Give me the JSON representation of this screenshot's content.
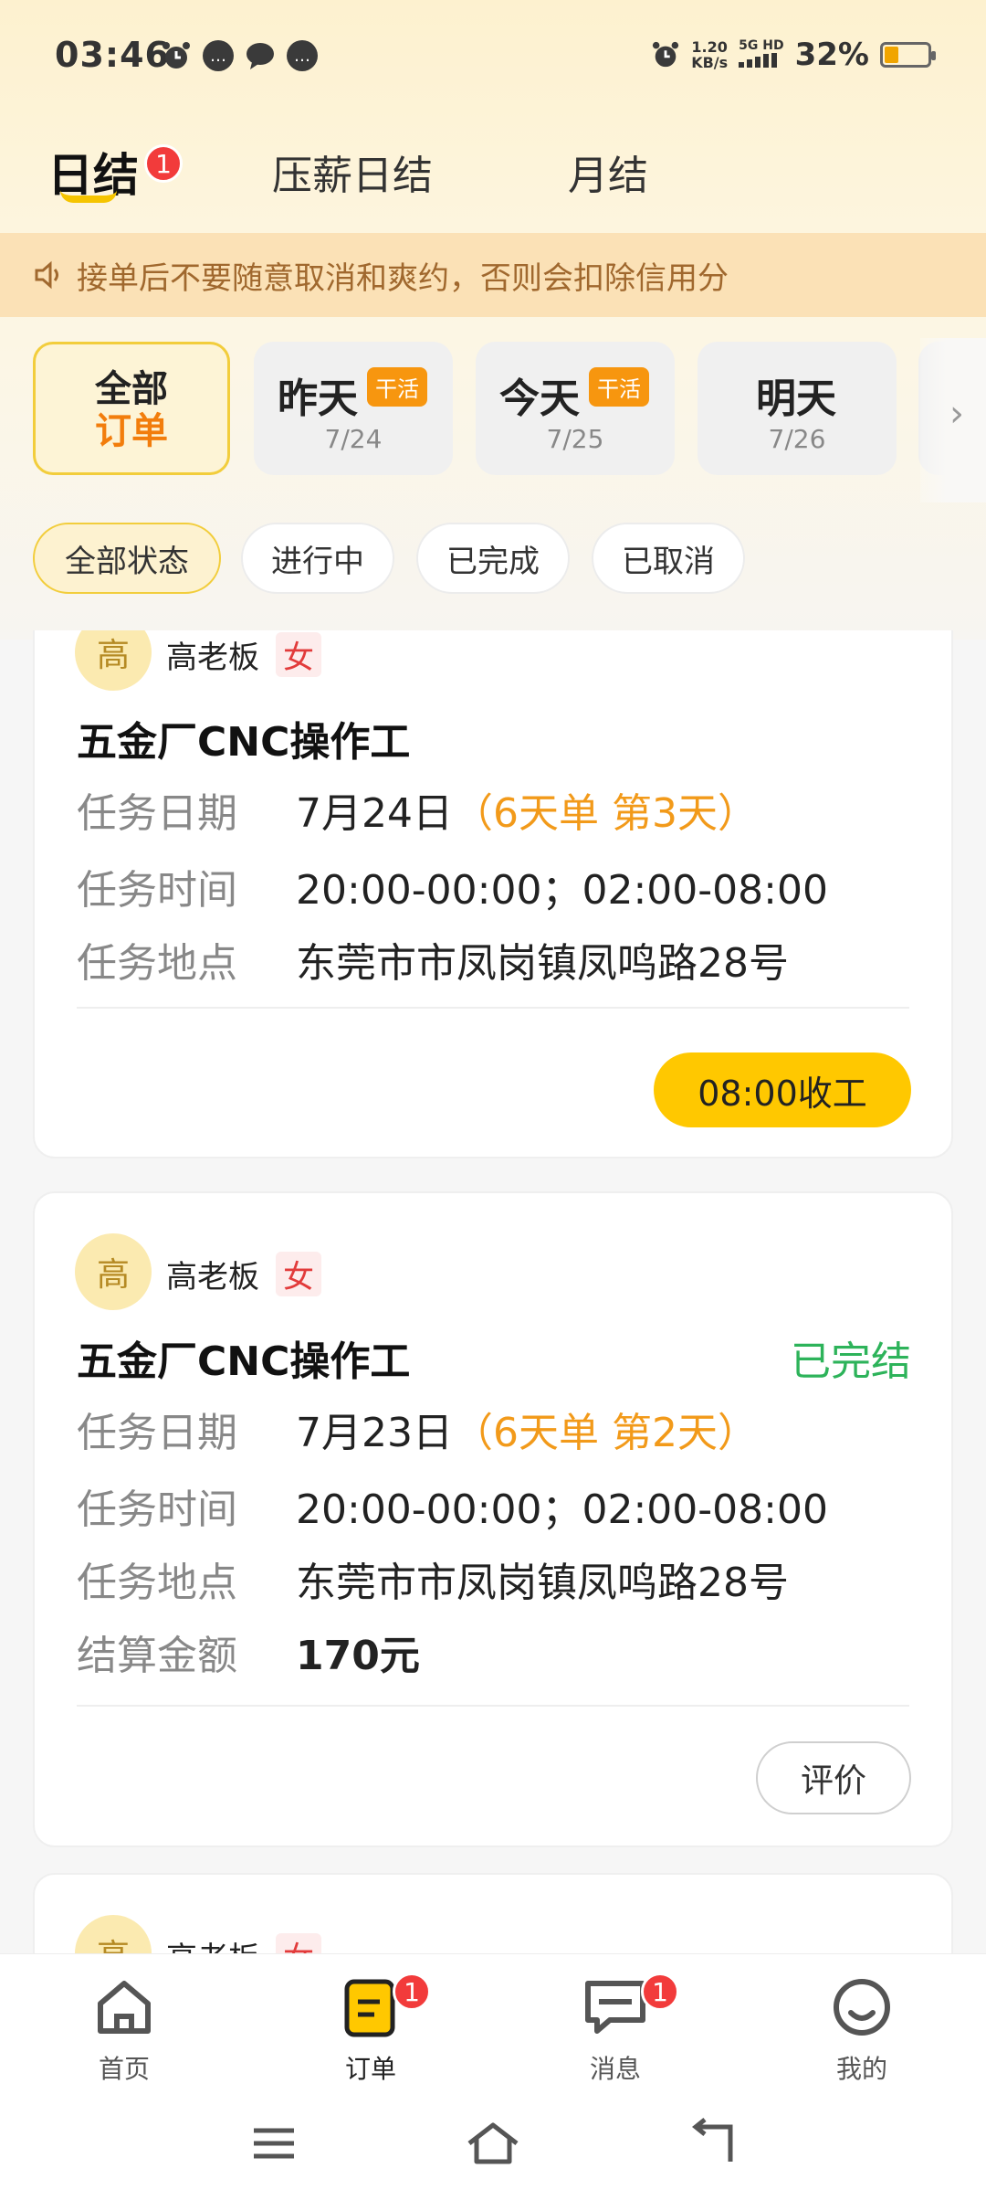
{
  "statusbar": {
    "time": "03:46",
    "speed_value": "1.20",
    "speed_unit": "KB/s",
    "network": "5G HD",
    "battery": "32%",
    "battery_level": 0.32
  },
  "tabs": [
    {
      "label": "日结",
      "badge": "1"
    },
    {
      "label": "压薪日结"
    },
    {
      "label": "月结"
    }
  ],
  "notice": "接单后不要随意取消和爽约，否则会扣除信用分",
  "dates": {
    "all_line1": "全部",
    "all_line2": "订单",
    "items": [
      {
        "label": "昨天",
        "date": "7/24",
        "tag": "干活"
      },
      {
        "label": "今天",
        "date": "7/25",
        "tag": "干活"
      },
      {
        "label": "明天",
        "date": "7/26"
      }
    ]
  },
  "filters": [
    "全部状态",
    "进行中",
    "已完成",
    "已取消"
  ],
  "orders": [
    {
      "avatar": "高",
      "owner": "高老板",
      "gender": "女",
      "job": "五金厂CNC操作工",
      "status": "",
      "date_label": "任务日期",
      "date_value": "7月24日",
      "date_extra": "（6天单 第3天）",
      "time_label": "任务时间",
      "time_value": "20:00-00:00；02:00-08:00",
      "place_label": "任务地点",
      "place_value": "东莞市市凤岗镇凤鸣路28号",
      "button": "08:00收工"
    },
    {
      "avatar": "高",
      "owner": "高老板",
      "gender": "女",
      "job": "五金厂CNC操作工",
      "status": "已完结",
      "date_label": "任务日期",
      "date_value": "7月23日",
      "date_extra": "（6天单 第2天）",
      "time_label": "任务时间",
      "time_value": "20:00-00:00；02:00-08:00",
      "place_label": "任务地点",
      "place_value": "东莞市市凤岗镇凤鸣路28号",
      "amount_label": "结算金额",
      "amount_value": "170元",
      "button": "评价"
    },
    {
      "avatar": "高",
      "owner": "高老板",
      "gender": "女"
    }
  ],
  "nav": [
    {
      "label": "首页"
    },
    {
      "label": "订单",
      "badge": "1"
    },
    {
      "label": "消息",
      "badge": "1"
    },
    {
      "label": "我的"
    }
  ],
  "colors": {
    "accent": "#ffc800",
    "orange": "#f7960f",
    "badge": "#f23b3b",
    "done": "#2db35a"
  }
}
